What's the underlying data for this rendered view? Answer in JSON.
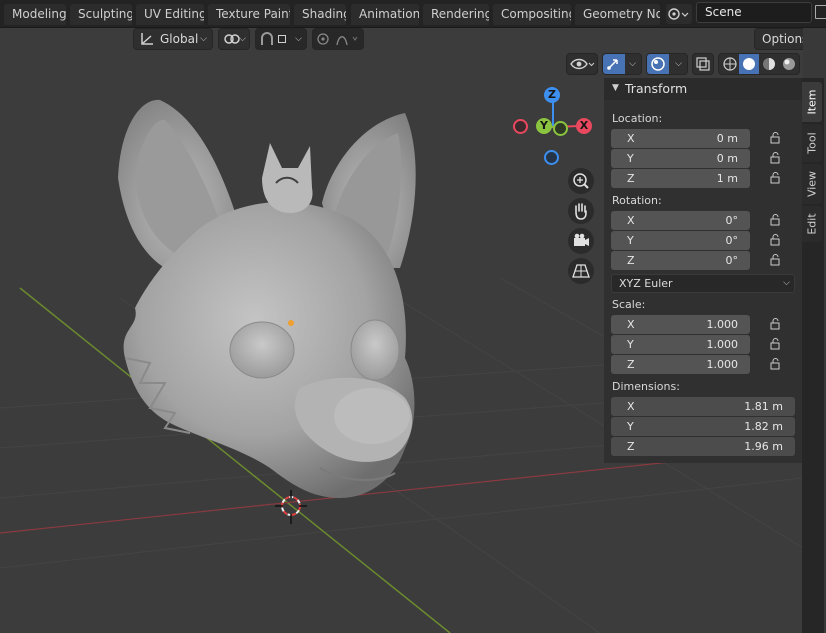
{
  "workspace_tabs": [
    "Modeling",
    "Sculpting",
    "UV Editing",
    "Texture Paint",
    "Shading",
    "Animation",
    "Rendering",
    "Compositing",
    "Geometry Nod"
  ],
  "scene": {
    "name": "Scene"
  },
  "toolbar": {
    "orientation": "Global",
    "options": "Options"
  },
  "gizmo": {
    "z": "Z",
    "y": "Y",
    "x": "X"
  },
  "npanel": {
    "title": "Transform",
    "location_label": "Location:",
    "location": [
      {
        "axis": "X",
        "value": "0 m"
      },
      {
        "axis": "Y",
        "value": "0 m"
      },
      {
        "axis": "Z",
        "value": "1 m"
      }
    ],
    "rotation_label": "Rotation:",
    "rotation": [
      {
        "axis": "X",
        "value": "0°"
      },
      {
        "axis": "Y",
        "value": "0°"
      },
      {
        "axis": "Z",
        "value": "0°"
      }
    ],
    "rotation_mode": "XYZ Euler",
    "scale_label": "Scale:",
    "scale": [
      {
        "axis": "X",
        "value": "1.000"
      },
      {
        "axis": "Y",
        "value": "1.000"
      },
      {
        "axis": "Z",
        "value": "1.000"
      }
    ],
    "dimensions_label": "Dimensions:",
    "dimensions": [
      {
        "axis": "X",
        "value": "1.81 m"
      },
      {
        "axis": "Y",
        "value": "1.82 m"
      },
      {
        "axis": "Z",
        "value": "1.96 m"
      }
    ]
  },
  "side_tabs": [
    "Item",
    "Tool",
    "View",
    "Edit"
  ],
  "colors": {
    "x_axis": "#e9485e",
    "y_axis": "#8bc53f",
    "z_axis": "#3d8ff0",
    "active_tab": "#3b3b3b"
  },
  "icons": [
    "transform-orientation-icon",
    "pivot-icon",
    "snap-icon",
    "proportional-edit-icon",
    "visibility-icon",
    "gizmo-toggle-icon",
    "overlay-icon",
    "xray-icon",
    "shading-wireframe-icon",
    "shading-solid-icon",
    "shading-material-icon",
    "shading-rendered-icon",
    "zoom-icon",
    "pan-hand-icon",
    "camera-icon",
    "perspective-grid-icon",
    "lock-icon"
  ]
}
